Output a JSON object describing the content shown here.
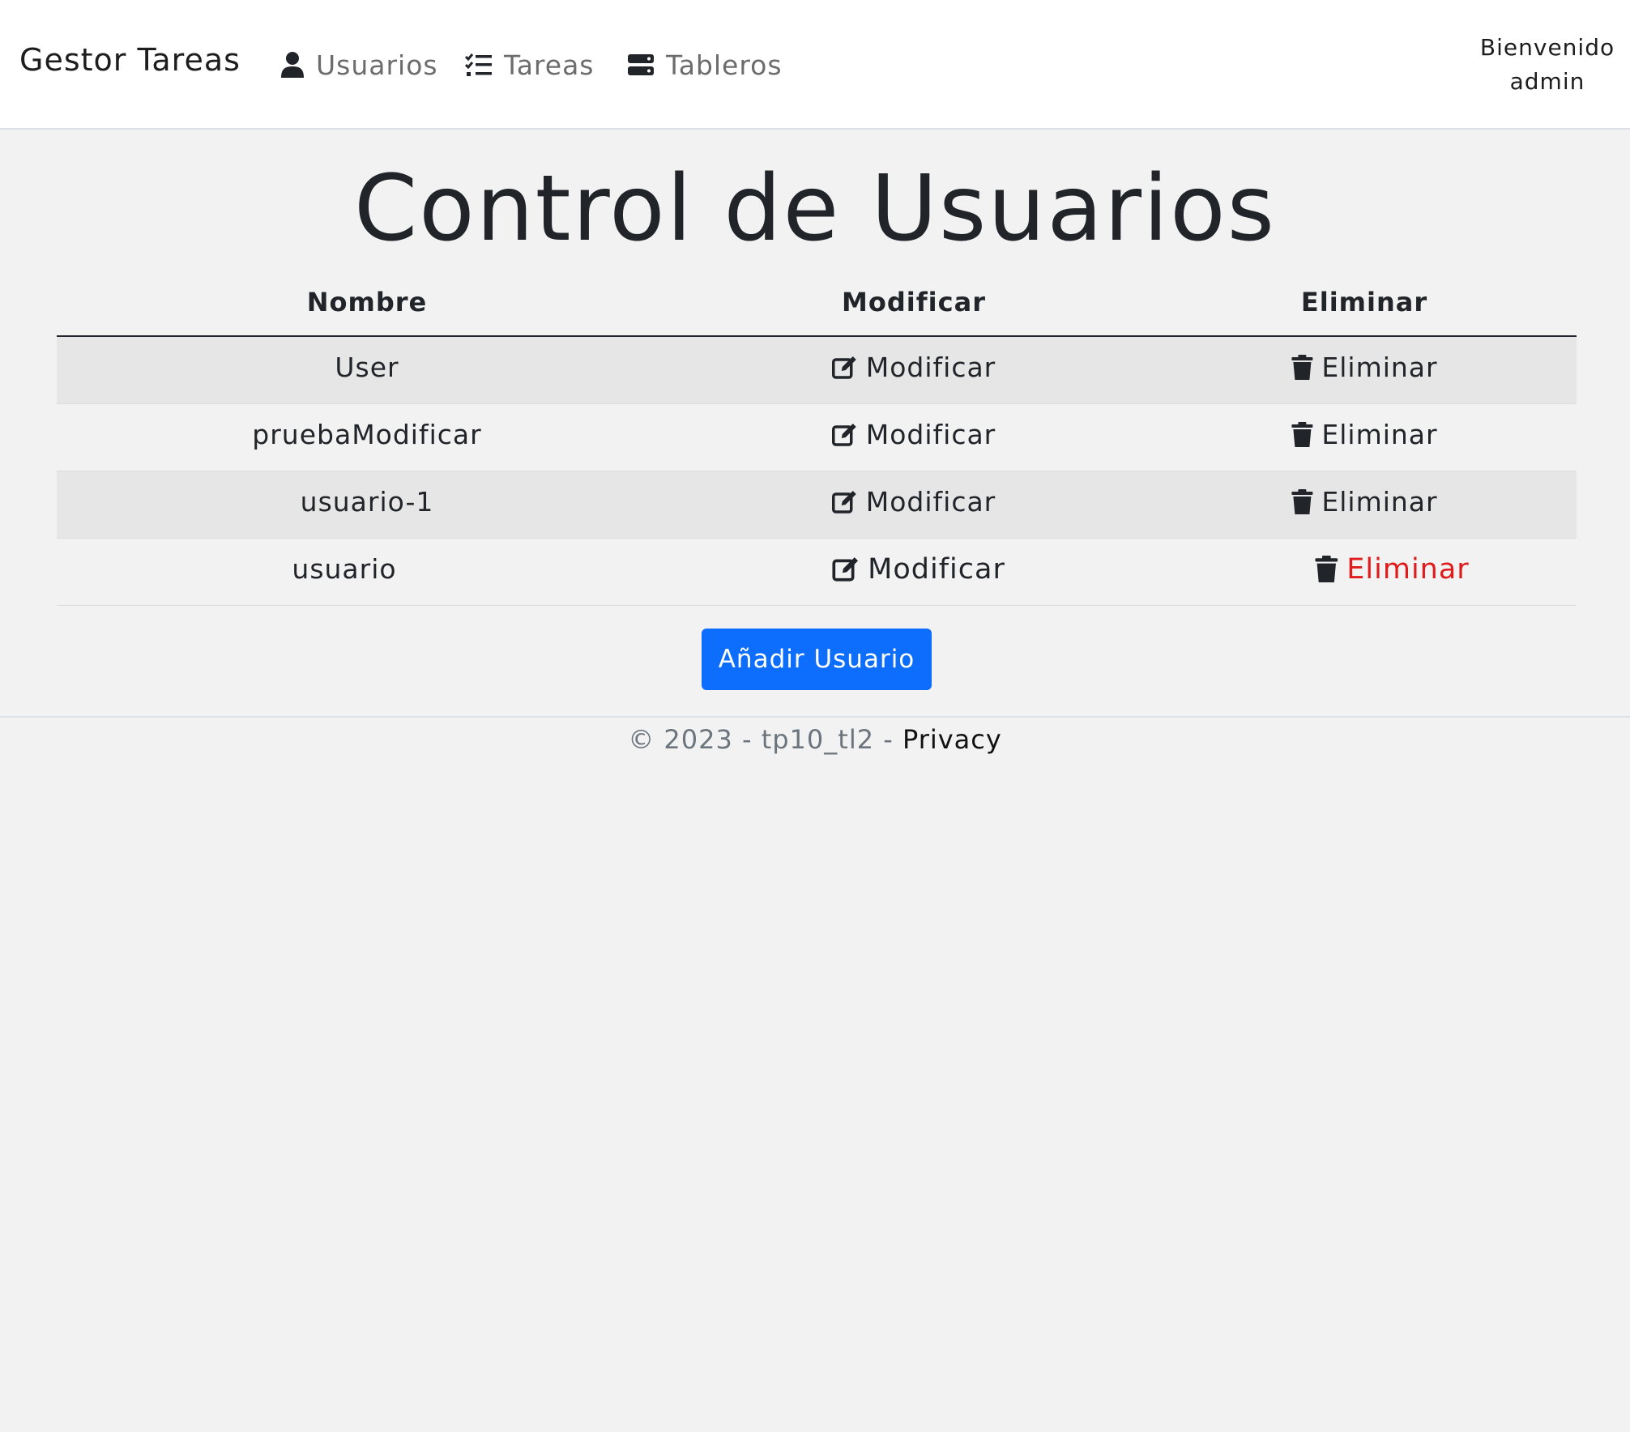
{
  "navbar": {
    "brand": "Gestor Tareas",
    "items": [
      {
        "label": "Usuarios",
        "icon": "user-icon"
      },
      {
        "label": "Tareas",
        "icon": "task-list-icon"
      },
      {
        "label": "Tableros",
        "icon": "server-icon"
      }
    ],
    "welcome_line1": "Bienvenido",
    "welcome_line2": "admin"
  },
  "page": {
    "title": "Control de Usuarios"
  },
  "table": {
    "headers": [
      "Nombre",
      "Modificar",
      "Eliminar"
    ],
    "rows": [
      {
        "nombre": "User",
        "modificar": "Modificar",
        "eliminar": "Eliminar"
      },
      {
        "nombre": "pruebaModificar",
        "modificar": "Modificar",
        "eliminar": "Eliminar"
      },
      {
        "nombre": "usuario-1",
        "modificar": "Modificar",
        "eliminar": "Eliminar"
      },
      {
        "nombre": "usuario",
        "modificar": "Modificar",
        "eliminar": "Eliminar"
      }
    ]
  },
  "actions": {
    "add_user": "Añadir Usuario"
  },
  "footer": {
    "copyright": "© 2023 - tp10_tl2 - ",
    "privacy": "Privacy"
  },
  "colors": {
    "primary": "#0d6efd",
    "danger_hover": "#e01b1b",
    "striped_row": "#e6e6e6",
    "background": "#f2f2f2"
  }
}
